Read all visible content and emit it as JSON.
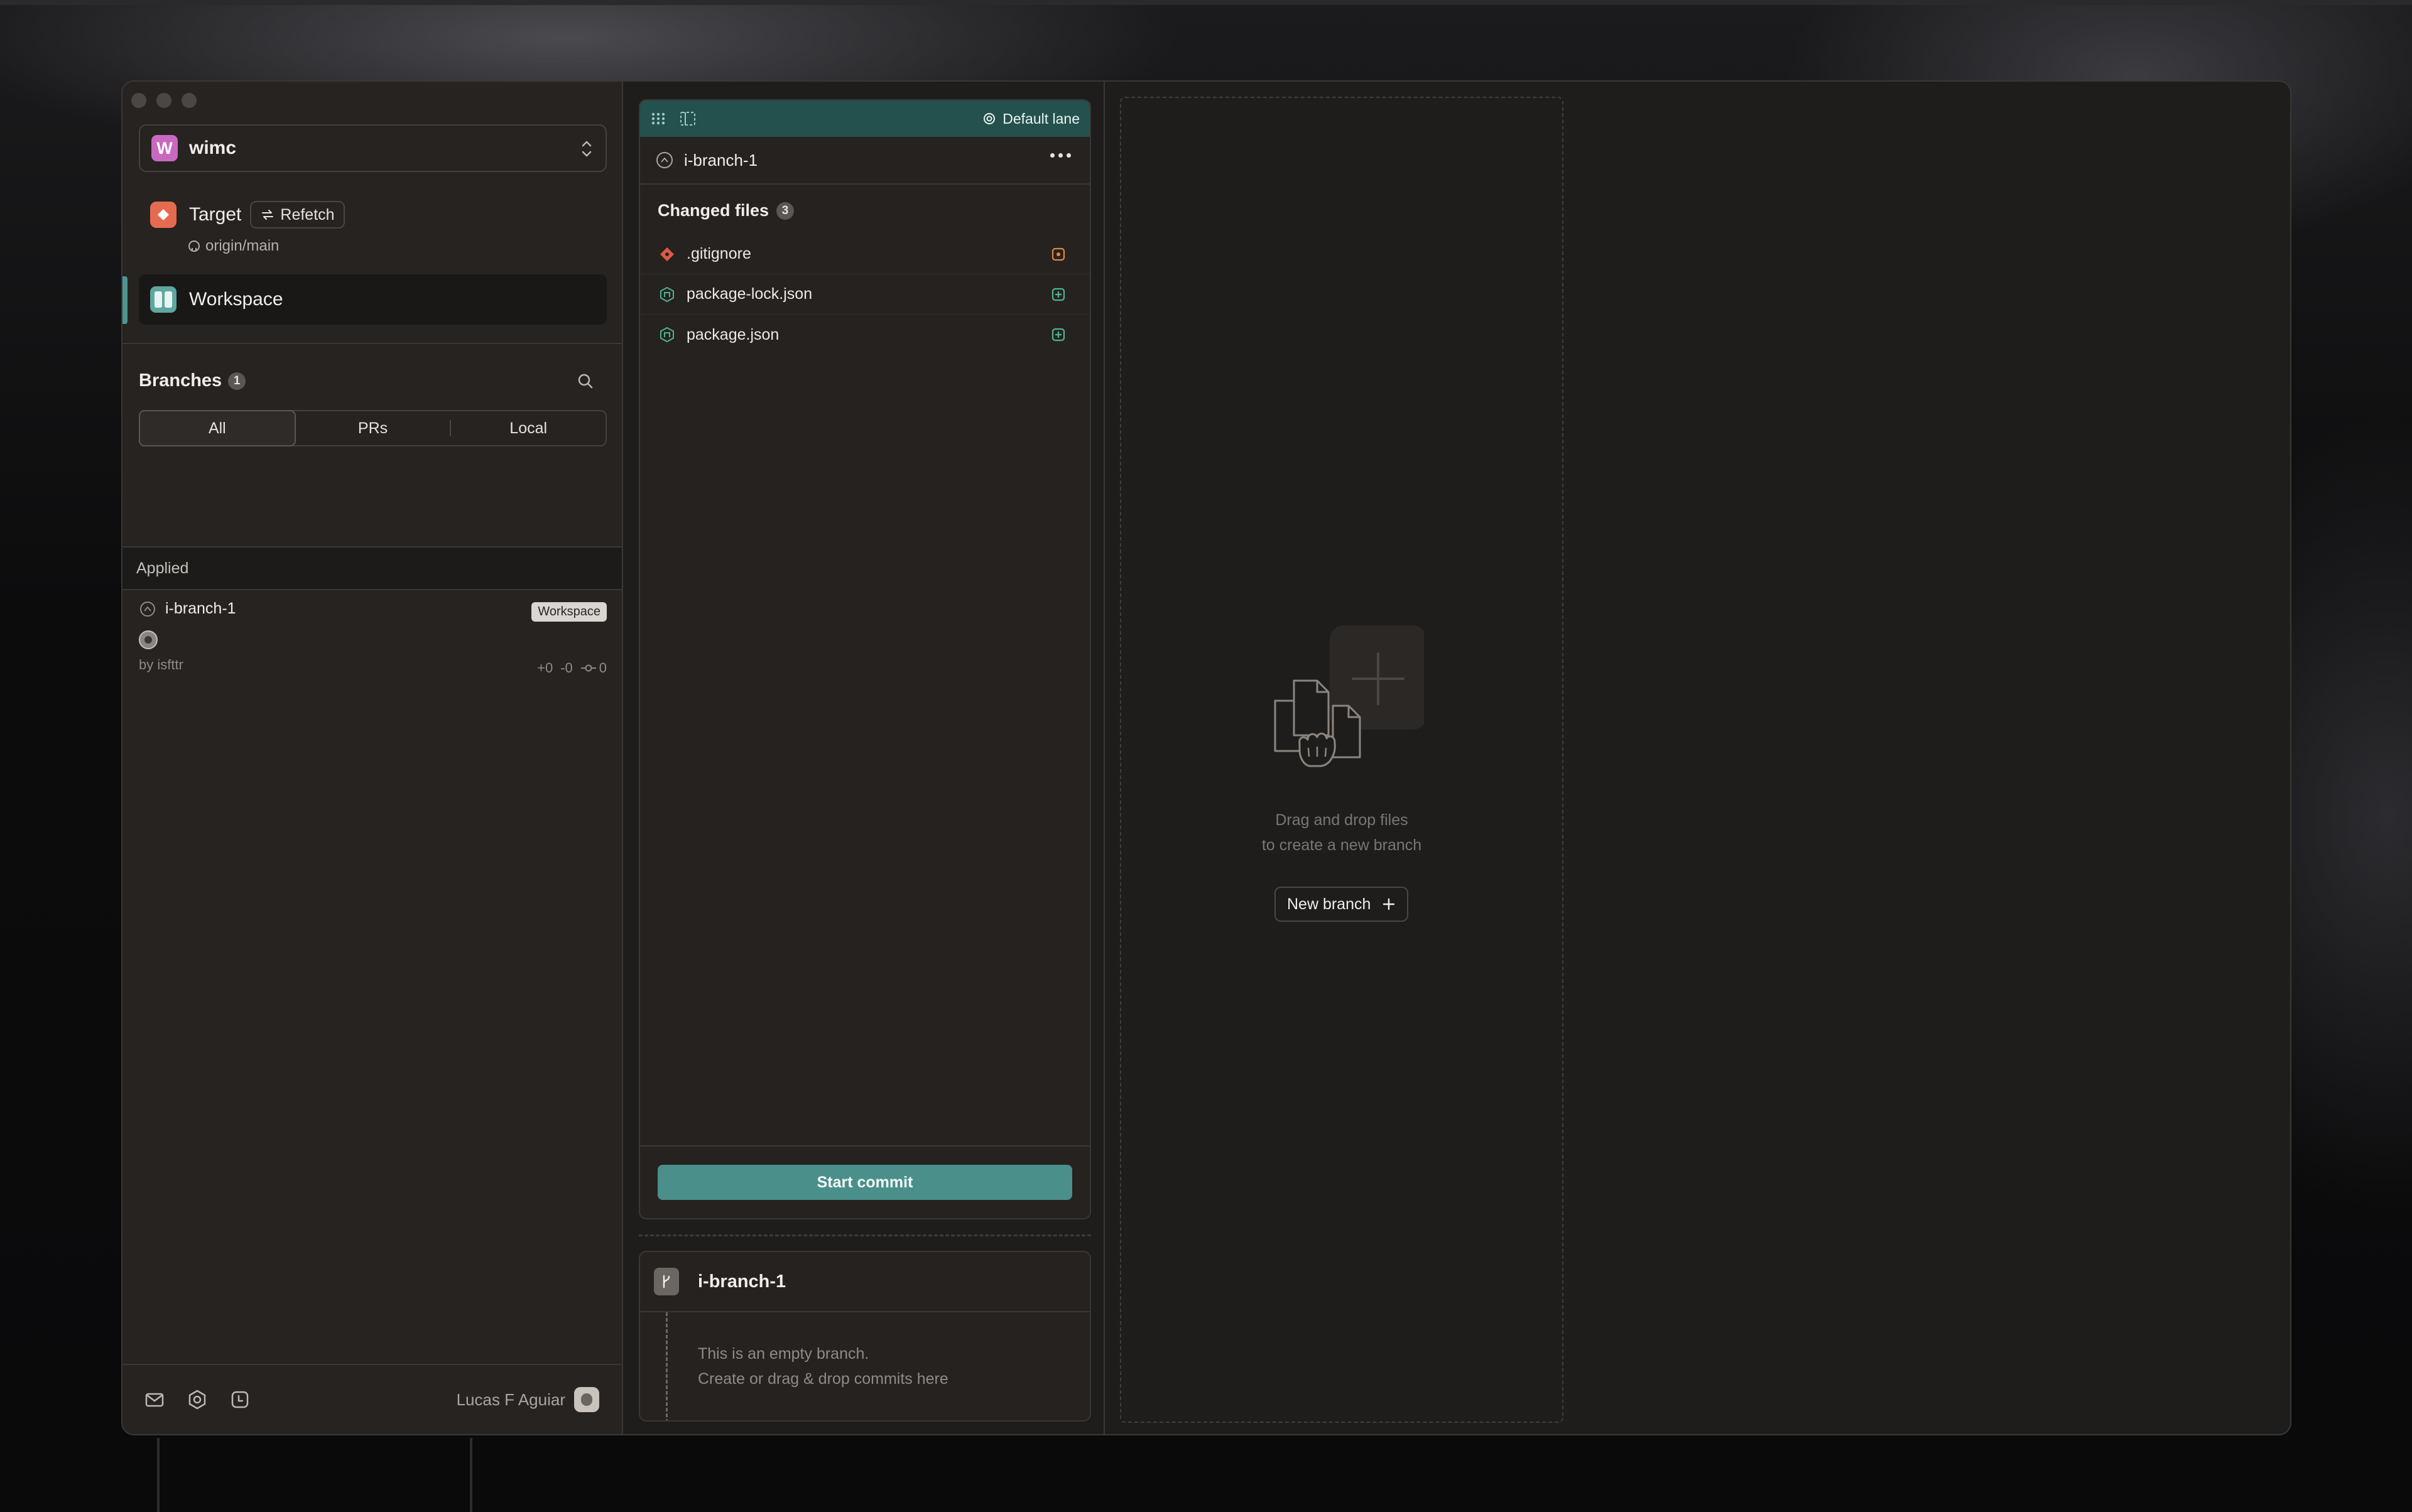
{
  "project": {
    "badge": "W",
    "name": "wimc"
  },
  "target": {
    "label": "Target",
    "refetch_label": "Refetch",
    "remote": "origin/main"
  },
  "workspace": {
    "label": "Workspace"
  },
  "branches": {
    "title": "Branches",
    "count": "1",
    "tabs": [
      {
        "label": "All",
        "active": true
      },
      {
        "label": "PRs"
      },
      {
        "label": "Local"
      }
    ],
    "section_label": "Applied",
    "items": [
      {
        "name": "i-branch-1",
        "tag": "Workspace",
        "author": "by isfttr",
        "added": "+0",
        "removed": "-0",
        "commits": "0"
      }
    ]
  },
  "footer": {
    "user_name": "Lucas F Aguiar"
  },
  "lane": {
    "default_lane_label": "Default lane",
    "branch_name": "i-branch-1",
    "changed_files_title": "Changed files",
    "changed_files_count": "3",
    "files": [
      {
        "name": ".gitignore",
        "icon": "git-icon",
        "status": "modified",
        "status_color": "#e0883a"
      },
      {
        "name": "package-lock.json",
        "icon": "npm-icon",
        "status": "added",
        "status_color": "#4fb38f"
      },
      {
        "name": "package.json",
        "icon": "npm-icon",
        "status": "added",
        "status_color": "#4fb38f"
      }
    ],
    "start_commit_label": "Start commit"
  },
  "branch_card": {
    "name": "i-branch-1",
    "empty_line1": "This is an empty branch.",
    "empty_line2": "Create or drag & drop commits here"
  },
  "dropzone": {
    "line1": "Drag and drop files",
    "line2": "to create a new branch",
    "new_branch_label": "New branch"
  },
  "colors": {
    "accent": "#4b8f8a",
    "lane_header": "#24514e",
    "target": "#e56b50",
    "project": "#c968c1"
  }
}
